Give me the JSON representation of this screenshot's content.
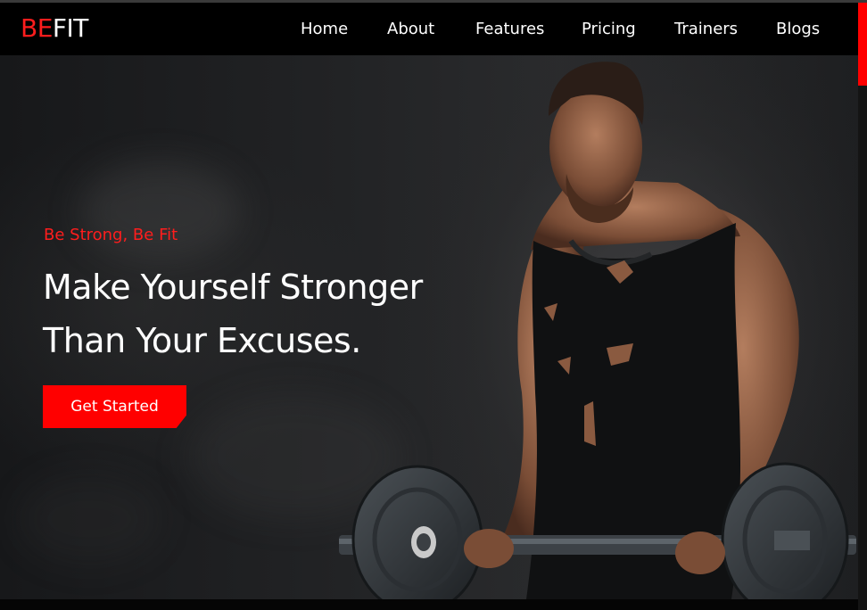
{
  "brand": {
    "logo_red": "BE",
    "logo_white": "FIT",
    "accent_color": "#ff1d1d"
  },
  "nav": {
    "items": [
      {
        "label": "Home"
      },
      {
        "label": "About"
      },
      {
        "label": "Features"
      },
      {
        "label": "Pricing"
      },
      {
        "label": "Trainers"
      },
      {
        "label": "Blogs"
      }
    ]
  },
  "hero": {
    "tagline": "Be Strong, Be Fit",
    "headline_line1": "Make Yourself Stronger",
    "headline_line2": "Than Your Excuses.",
    "cta_label": "Get Started",
    "image_subject": "bodybuilder-lifting-barbell"
  }
}
